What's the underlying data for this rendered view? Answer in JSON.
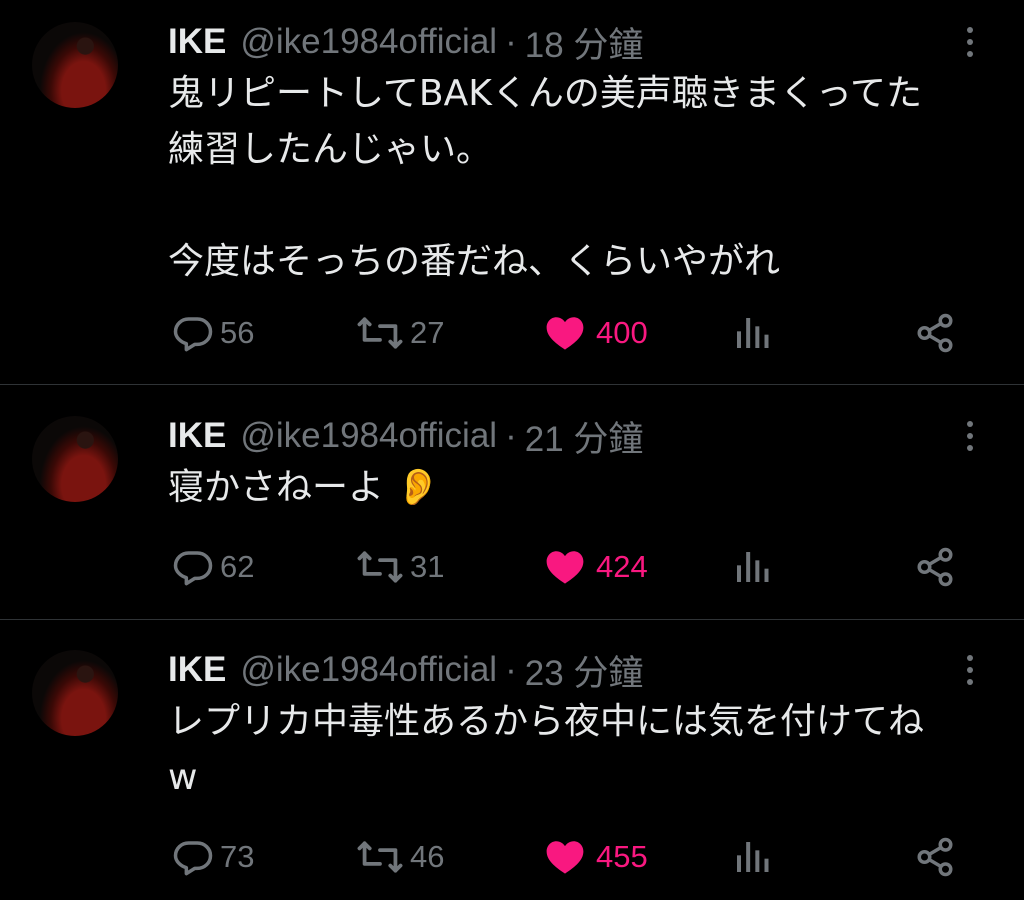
{
  "tweets": [
    {
      "name": "IKE",
      "handle": "@ike1984official",
      "dot": "·",
      "time": "18 分鐘",
      "text": "鬼リピートしてBAKくんの美声聴きまくってた\n練習したんじゃい。\n\n今度はそっちの番だね、くらいやがれ",
      "replies": "56",
      "retweets": "27",
      "likes": "400"
    },
    {
      "name": "IKE",
      "handle": "@ike1984official",
      "dot": "·",
      "time": "21 分鐘",
      "text": "寝かさねーよ 👂",
      "replies": "62",
      "retweets": "31",
      "likes": "424"
    },
    {
      "name": "IKE",
      "handle": "@ike1984official",
      "dot": "·",
      "time": "23 分鐘",
      "text": "レプリカ中毒性あるから夜中には気を付けてね\nw",
      "replies": "73",
      "retweets": "46",
      "likes": "455"
    }
  ],
  "colors": {
    "like": "#f91880",
    "muted": "#71767b",
    "text": "#e7e9ea",
    "divider": "#2f3336"
  },
  "icons": [
    "avatar",
    "more-icon",
    "reply-icon",
    "retweet-icon",
    "like-icon",
    "views-icon",
    "share-icon"
  ]
}
